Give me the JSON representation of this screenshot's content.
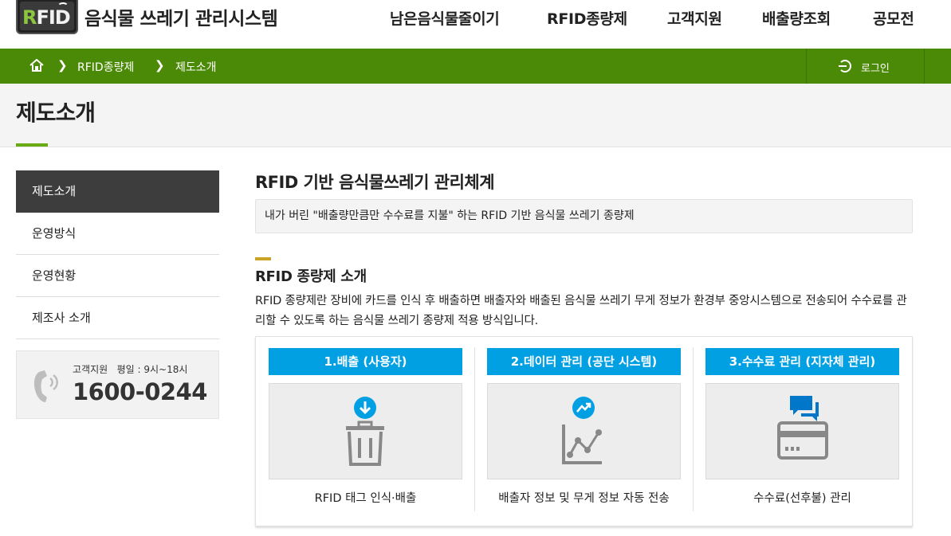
{
  "header": {
    "logo_text": "RFID",
    "site_title": "음식물 쓰레기 관리시스템",
    "nav": [
      "남은음식물줄이기",
      "RFID종량제",
      "고객지원",
      "배출량조회",
      "공모전"
    ]
  },
  "breadcrumb": {
    "items": [
      "RFID종량제",
      "제도소개"
    ],
    "login_label": "로그인"
  },
  "page": {
    "title": "제도소개"
  },
  "sidebar": {
    "items": [
      {
        "label": "제도소개",
        "active": true
      },
      {
        "label": "운영방식",
        "active": false
      },
      {
        "label": "운영현황",
        "active": false
      },
      {
        "label": "제조사 소개",
        "active": false
      }
    ],
    "customer_service": {
      "label": "고객지원   평일 : 9시~18시",
      "number": "1600-0244"
    }
  },
  "main": {
    "heading": "RFID 기반 음식물쓰레기 관리체계",
    "summary": "내가 버린 \"배출량만큼만 수수료를 지불\" 하는 RFID 기반 음식물 쓰레기 종량제",
    "subheading": "RFID 종량제 소개",
    "description": "RFID 종량제란 장비에 카드를 인식 후 배출하면 배출자와 배출된 음식물 쓰레기 무게 정보가 환경부 중앙시스템으로 전송되어 수수료를 관리할 수 있도록 하는 음식물 쓰레기 종량제 적용 방식입니다.",
    "steps": [
      {
        "label": "1.배출 (사용자)",
        "icon": "trash-download-icon",
        "caption": "RFID 태그 인식·배출"
      },
      {
        "label": "2.데이터 관리 (공단 시스템)",
        "icon": "chart-trend-icon",
        "caption": "배출자 정보 및 무게 정보 자동 전송"
      },
      {
        "label": "3.수수료 관리 (지자체 관리)",
        "icon": "card-chat-icon",
        "caption": "수수료(선후불) 관리"
      }
    ]
  },
  "colors": {
    "nav_green": "#4b8a06",
    "step_blue": "#00a0e3",
    "accent_gold": "#c9a227"
  }
}
